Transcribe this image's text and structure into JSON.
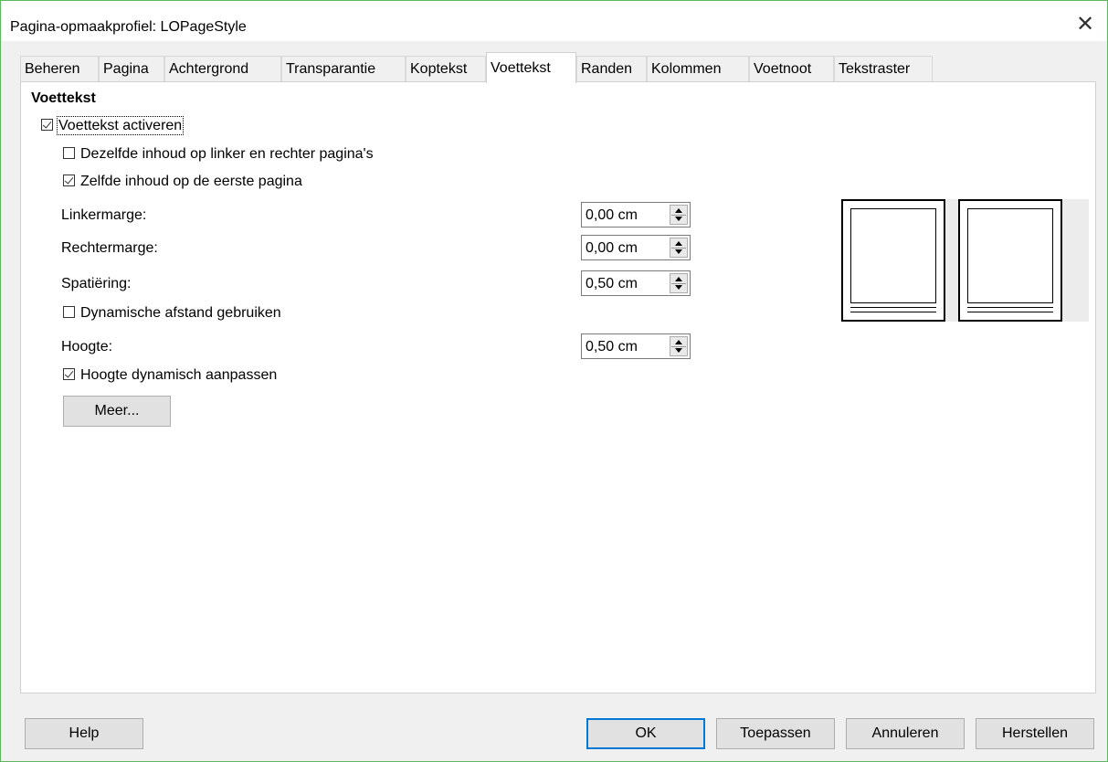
{
  "window": {
    "title": "Pagina-opmaakprofiel: LOPageStyle",
    "close_glyph": "✕"
  },
  "tabs": [
    {
      "label": "Beheren"
    },
    {
      "label": "Pagina"
    },
    {
      "label": "Achtergrond"
    },
    {
      "label": "Transparantie"
    },
    {
      "label": "Koptekst"
    },
    {
      "label": "Voettekst",
      "active": true
    },
    {
      "label": "Randen"
    },
    {
      "label": "Kolommen"
    },
    {
      "label": "Voetnoot"
    },
    {
      "label": "Tekstraster"
    }
  ],
  "footer_section": {
    "title": "Voettekst",
    "enable": {
      "label": "Voettekst activeren",
      "checked": true
    },
    "same_content_lr": {
      "label": "Dezelfde inhoud op linker en rechter pagina's",
      "checked": false
    },
    "same_content_first": {
      "label": "Zelfde inhoud op de eerste pagina",
      "checked": true
    },
    "left_margin": {
      "label": "Linkermarge:",
      "value": "0,00 cm"
    },
    "right_margin": {
      "label": "Rechtermarge:",
      "value": "0,00 cm"
    },
    "spacing": {
      "label": "Spatiëring:",
      "value": "0,50 cm"
    },
    "dynamic_spacing": {
      "label": "Dynamische afstand gebruiken",
      "checked": false
    },
    "height": {
      "label": "Hoogte:",
      "value": "0,50 cm"
    },
    "autofit_height": {
      "label": "Hoogte dynamisch aanpassen",
      "checked": true
    },
    "more_button": "Meer..."
  },
  "buttons": {
    "help": "Help",
    "ok": "OK",
    "apply": "Toepassen",
    "cancel": "Annuleren",
    "reset": "Herstellen"
  },
  "colors": {
    "window_border": "#5cb85c",
    "default_button_border": "#0078d7"
  }
}
